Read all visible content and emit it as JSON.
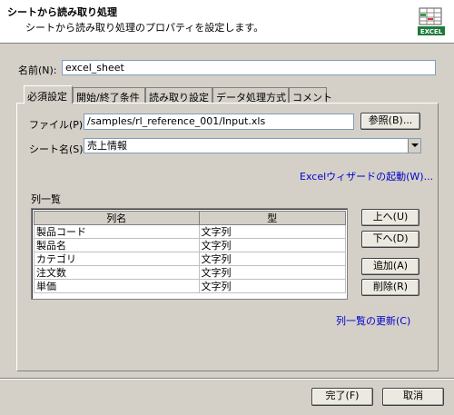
{
  "header": {
    "title": "シートから読み取り処理",
    "description": "シートから読み取り処理のプロパティを設定します。",
    "icon_label": "EXCEL"
  },
  "name": {
    "label": "名前(N):",
    "value": "excel_sheet"
  },
  "tabs": [
    {
      "label": "必須設定",
      "active": true
    },
    {
      "label": "開始/終了条件",
      "active": false
    },
    {
      "label": "読み取り設定",
      "active": false
    },
    {
      "label": "データ処理方式",
      "active": false
    },
    {
      "label": "コメント",
      "active": false
    }
  ],
  "file": {
    "label": "ファイル(P):",
    "value": "/samples/rl_reference_001/Input.xls",
    "browse_label": "参照(B)..."
  },
  "sheet": {
    "label": "シート名(S):",
    "value": "売上情報"
  },
  "excel_wizard_link": "Excelウィザードの起動(W)...",
  "column_list": {
    "label": "列一覧",
    "headers": [
      "列名",
      "型"
    ],
    "rows": [
      [
        "製品コード",
        "文字列"
      ],
      [
        "製品名",
        "文字列"
      ],
      [
        "カテゴリ",
        "文字列"
      ],
      [
        "注文数",
        "文字列"
      ],
      [
        "単価",
        "文字列"
      ]
    ]
  },
  "side_buttons": {
    "up": "上へ(U)",
    "down": "下へ(D)",
    "add": "追加(A)",
    "delete": "削除(R)"
  },
  "refresh_link": "列一覧の更新(C)",
  "footer": {
    "finish_label": "完了(F)",
    "cancel_label": "取消"
  },
  "colors": {
    "link": "#0000cc",
    "icon_green": "#1e7a3c"
  }
}
